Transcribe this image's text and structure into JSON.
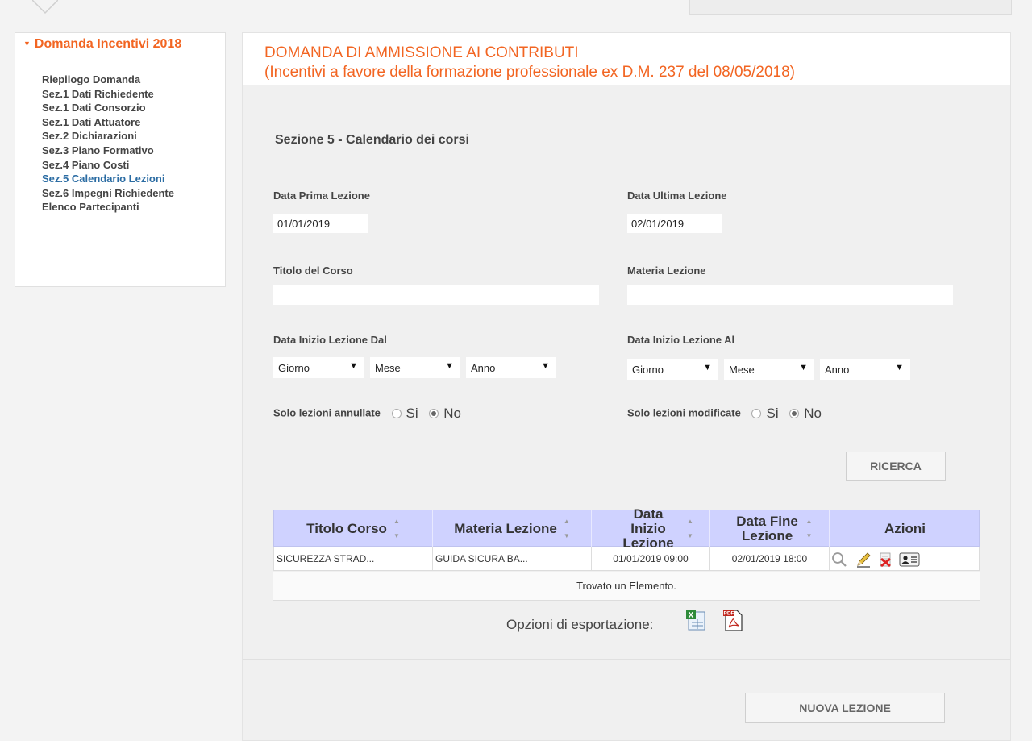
{
  "sidebar": {
    "title": "Domanda Incentivi 2018",
    "items": [
      {
        "label": "Riepilogo Domanda"
      },
      {
        "label": "Sez.1 Dati Richiedente"
      },
      {
        "label": "Sez.1 Dati Consorzio"
      },
      {
        "label": "Sez.1 Dati Attuatore"
      },
      {
        "label": "Sez.2 Dichiarazioni"
      },
      {
        "label": "Sez.3 Piano Formativo"
      },
      {
        "label": "Sez.4 Piano Costi"
      },
      {
        "label": "Sez.5 Calendario Lezioni"
      },
      {
        "label": "Sez.6 Impegni Richiedente"
      },
      {
        "label": "Elenco Partecipanti"
      }
    ],
    "active_index": 7,
    "active_color": "#2b6ca3"
  },
  "header": {
    "line1": "DOMANDA DI AMMISSIONE AI CONTRIBUTI",
    "line2": "(Incentivi a favore della formazione professionale ex D.M. 237 del 08/05/2018)",
    "color": "#f26522"
  },
  "form": {
    "section_title": "Sezione 5 - Calendario dei corsi",
    "data_prima_label": "Data Prima Lezione",
    "data_prima_value": "01/01/2019",
    "data_ultima_label": "Data Ultima Lezione",
    "data_ultima_value": "02/01/2019",
    "titolo_corso_label": "Titolo del Corso",
    "titolo_corso_value": "",
    "materia_label": "Materia Lezione",
    "materia_value": "",
    "inizio_dal_label": "Data Inizio Lezione Dal",
    "inizio_al_label": "Data Inizio Lezione Al",
    "select_giorno": "Giorno",
    "select_mese": "Mese",
    "select_anno": "Anno",
    "annullate_label": "Solo lezioni annullate",
    "modificate_label": "Solo lezioni modificate",
    "si": "Si",
    "no": "No",
    "search_button": "RICERCA"
  },
  "table": {
    "columns": [
      "Titolo Corso",
      "Materia Lezione",
      "Data Inizio Lezione",
      "Data Fine Lezione",
      "Azioni"
    ],
    "rows": [
      {
        "titolo": "SICUREZZA STRAD...",
        "materia": "GUIDA SICURA BA...",
        "inizio": "01/01/2019 09:00",
        "fine": "02/01/2019 18:00"
      }
    ],
    "actions_icons": [
      "search-icon",
      "edit-pencil-icon",
      "delete-icon",
      "participants-card-icon"
    ],
    "footer": "Trovato un Elemento.",
    "header_bg": "#cfd2ff"
  },
  "export": {
    "label": "Opzioni di esportazione:",
    "icons": [
      "excel-export-icon",
      "pdf-export-icon"
    ]
  },
  "new_button": "NUOVA LEZIONE"
}
